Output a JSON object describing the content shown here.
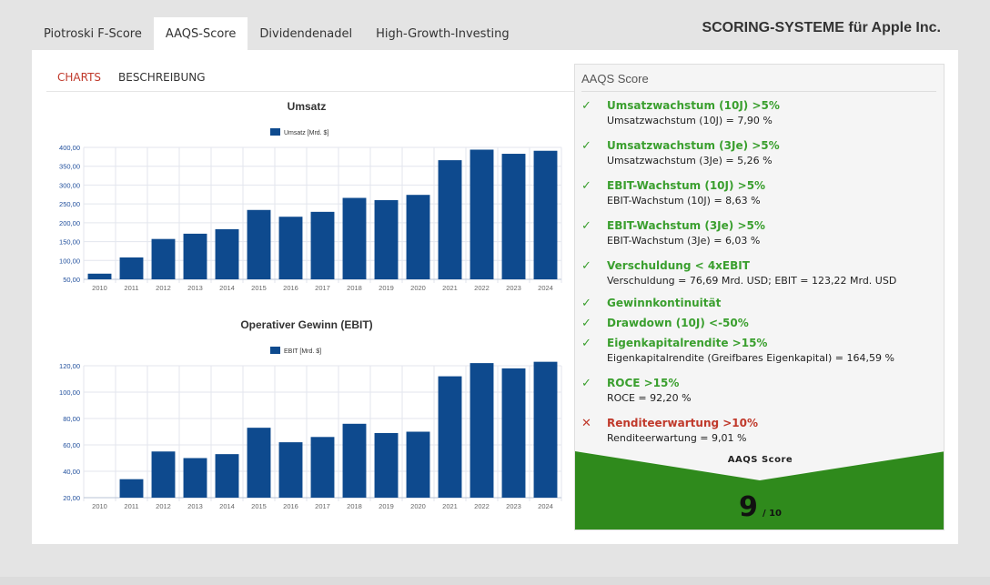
{
  "header": {
    "tabs": [
      "Piotroski F-Score",
      "AAQS-Score",
      "Dividendenadel",
      "High-Growth-Investing"
    ],
    "active_tab": "AAQS-Score",
    "title": "SCORING-SYSTEME für Apple Inc."
  },
  "subtabs": {
    "charts": "CHARTS",
    "beschreibung": "BESCHREIBUNG"
  },
  "colors": {
    "bar": "#0e4a8e",
    "ok": "#3a9f2e",
    "fail": "#c0392b",
    "score_green": "#2f8a1c"
  },
  "chart_data": [
    {
      "type": "bar",
      "title": "Umsatz",
      "legend": "Umsatz [Mrd. $]",
      "categories": [
        "2010",
        "2011",
        "2012",
        "2013",
        "2014",
        "2015",
        "2016",
        "2017",
        "2018",
        "2019",
        "2020",
        "2021",
        "2022",
        "2023",
        "2024"
      ],
      "values": [
        65,
        108,
        157,
        171,
        183,
        234,
        216,
        229,
        266,
        260,
        274,
        366,
        394,
        383,
        391
      ],
      "yticks": [
        "50,00",
        "100,00",
        "150,00",
        "200,00",
        "250,00",
        "300,00",
        "350,00",
        "400,00"
      ],
      "ylim": [
        50,
        400
      ],
      "grid": true,
      "legend_position": "top-center"
    },
    {
      "type": "bar",
      "title": "Operativer Gewinn (EBIT)",
      "legend": "EBIT [Mrd. $]",
      "categories": [
        "2010",
        "2011",
        "2012",
        "2013",
        "2014",
        "2015",
        "2016",
        "2017",
        "2018",
        "2019",
        "2020",
        "2021",
        "2022",
        "2023",
        "2024"
      ],
      "values": [
        18,
        34,
        55,
        50,
        53,
        73,
        62,
        66,
        76,
        69,
        70,
        112,
        122,
        118,
        123
      ],
      "yticks": [
        "20,00",
        "40,00",
        "60,00",
        "80,00",
        "100,00",
        "120,00"
      ],
      "ylim": [
        20,
        120
      ],
      "grid": true,
      "legend_position": "top-center"
    }
  ],
  "score": {
    "heading": "AAQS Score",
    "criteria": [
      {
        "ok": true,
        "title": "Umsatzwachstum (10J) >5%",
        "detail": "Umsatzwachstum (10J) = 7,90 %"
      },
      {
        "ok": true,
        "title": "Umsatzwachstum (3Je) >5%",
        "detail": "Umsatzwachstum (3Je) = 5,26 %"
      },
      {
        "ok": true,
        "title": "EBIT-Wachstum (10J) >5%",
        "detail": "EBIT-Wachstum (10J) = 8,63 %"
      },
      {
        "ok": true,
        "title": "EBIT-Wachstum (3Je) >5%",
        "detail": "EBIT-Wachstum (3Je) = 6,03 %"
      },
      {
        "ok": true,
        "title": "Verschuldung < 4xEBIT",
        "detail": "Verschuldung = 76,69 Mrd. USD; EBIT = 123,22 Mrd. USD"
      },
      {
        "ok": true,
        "title": "Gewinnkontinuität",
        "detail": ""
      },
      {
        "ok": true,
        "title": "Drawdown (10J) <-50%",
        "detail": ""
      },
      {
        "ok": true,
        "title": "Eigenkapitalrendite >15%",
        "detail": "Eigenkapitalrendite (Greifbares Eigenkapital) = 164,59 %"
      },
      {
        "ok": true,
        "title": "ROCE >15%",
        "detail": "ROCE = 92,20 %"
      },
      {
        "ok": false,
        "title": "Renditeerwartung >10%",
        "detail": "Renditeerwartung = 9,01 %"
      }
    ],
    "ok_icon": "check-icon",
    "fail_icon": "cross-icon",
    "footer_label": "AAQS Score",
    "value": "9",
    "max": "/ 10"
  }
}
